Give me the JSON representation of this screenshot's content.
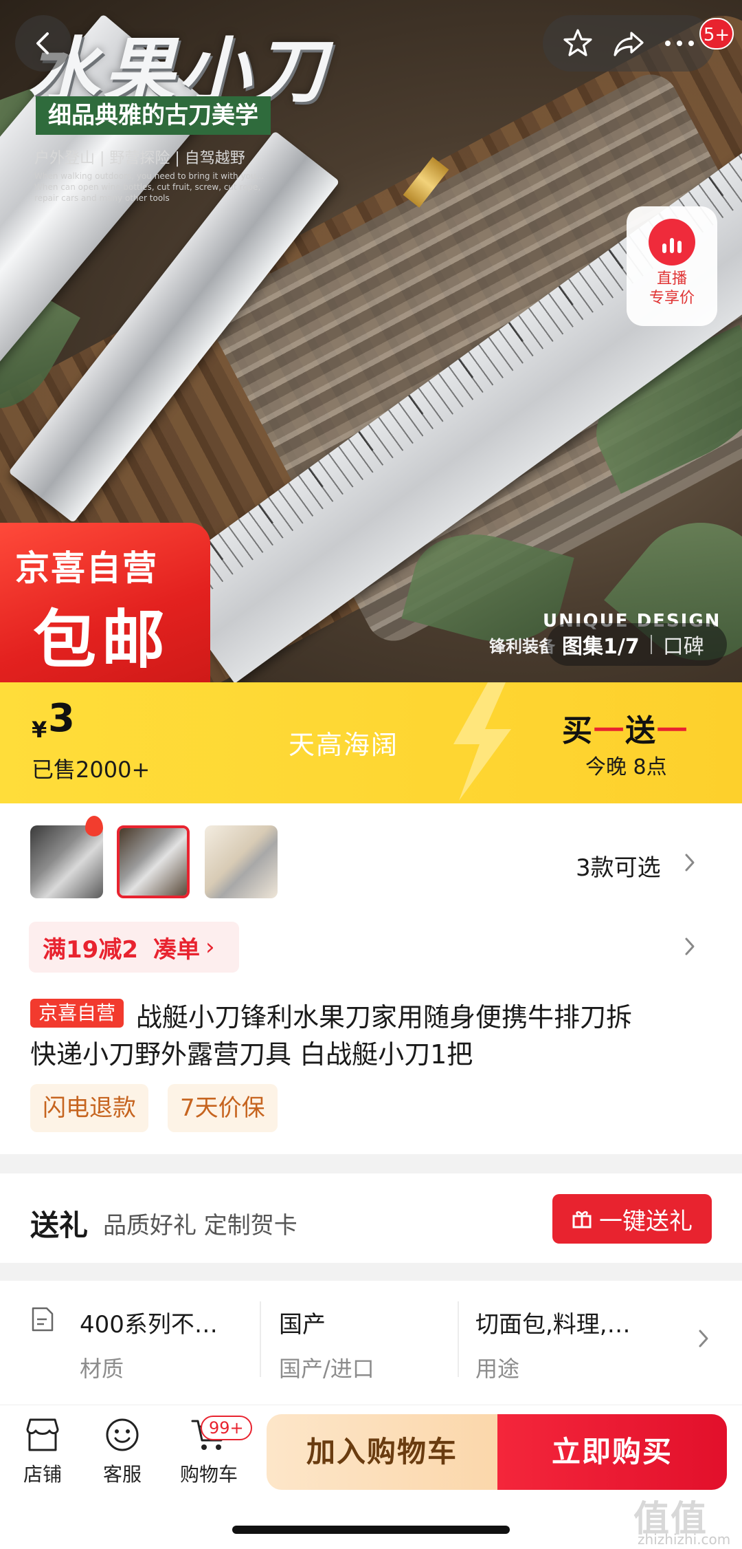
{
  "hero": {
    "title": "水果小刀",
    "slogan": "细品典雅的古刀美学",
    "tags": "户外登山 | 野营探险 | 自驾越野",
    "eng_text": "When walking outdoors, you need to bring it with you... When can open wine bottles, cut fruit, screw, cut rope, repair cars and many other tools",
    "badge_top": "京喜自营",
    "badge_bottom": "包邮",
    "design_text": "UNIQUE DESIGN",
    "caption": "锋利装备",
    "gallery_label": "图集1/7",
    "review_label": "口碑",
    "live_label_1": "直播",
    "live_label_2": "专享价",
    "notif_count": "5+"
  },
  "price": {
    "symbol": "¥",
    "value": "3",
    "sold": "已售2000+",
    "slogan": "天高海阔",
    "promo_a": "买",
    "promo_dash": "一",
    "promo_b": "送",
    "promo_c": "一",
    "promo_time": "今晚 8点"
  },
  "variants": {
    "count_label": "3款可选"
  },
  "coupon": {
    "text": "满19减2",
    "action": "凑单",
    "arrow": "›"
  },
  "product": {
    "badge": "京喜自营",
    "title_line1": "战艇小刀锋利水果刀家用随身便携牛排刀拆",
    "title_line2": "快递小刀野外露营刀具 白战艇小刀1把",
    "tags": [
      "闪电退款",
      "7天价保"
    ]
  },
  "gift": {
    "title": "送礼",
    "subtitle": "品质好礼 定制贺卡",
    "button": "一键送礼"
  },
  "attributes": [
    {
      "value": "400系列不…",
      "key": "材质"
    },
    {
      "value": "国产",
      "key": "国产/进口"
    },
    {
      "value": "切面包,料理,…",
      "key": "用途"
    }
  ],
  "bottom": {
    "store": "店铺",
    "service": "客服",
    "cart": "购物车",
    "cart_badge": "99+",
    "add_cart": "加入购物车",
    "buy_now": "立即购买"
  },
  "watermark": {
    "logo": "值值值",
    "url": "zhizhizhi.com"
  },
  "colors": {
    "accent_red": "#e8232f",
    "price_yellow": "#fed632",
    "tag_orange": "#c6641f"
  }
}
